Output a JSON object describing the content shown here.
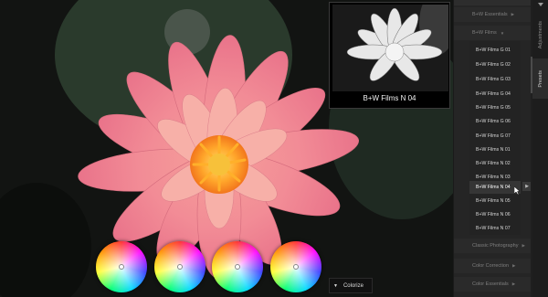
{
  "preview": {
    "label": "B+W Films N 04"
  },
  "colorize": {
    "label": "Colorize"
  },
  "panel": {
    "categories_top": [
      {
        "label": "B+W Essentials"
      },
      {
        "label": "B+W Films"
      }
    ],
    "submenu_items": [
      "B+W Films G 01",
      "B+W Films G 02",
      "B+W Films G 03",
      "B+W Films G 04",
      "B+W Films G 05",
      "B+W Films G 06",
      "B+W Films G 07",
      "B+W Films N 01",
      "B+W Films N 02",
      "B+W Films N 03",
      "B+W Films N 04",
      "B+W Films N 05",
      "B+W Films N 06",
      "B+W Films N 07"
    ],
    "selected_item": "B+W Films N 04",
    "categories_bottom": [
      {
        "label": "Classic Photography"
      },
      {
        "label": "Color Correction"
      },
      {
        "label": "Color Essentials"
      }
    ]
  },
  "tabs": [
    {
      "label": "Adjustments"
    },
    {
      "label": "Presets"
    }
  ],
  "colors": {
    "panel_bg": "#252525",
    "selected_row": "#353535",
    "canvas_bg": "#121412"
  }
}
